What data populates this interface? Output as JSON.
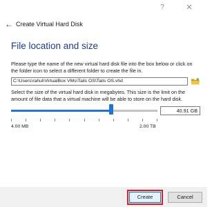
{
  "window": {
    "help_label": "?",
    "close_label": "✕"
  },
  "header": {
    "back_label": "←",
    "title": "Create Virtual Hard Disk"
  },
  "page": {
    "title": "File location and size",
    "location_description": "Please type the name of the new virtual hard disk file into the box below or click on the folder icon to select a different folder to create the file in.",
    "file_path": "C:\\Users\\rahul\\VirtualBox VMs\\Tails OS\\Tails OS.vhd",
    "size_description": "Select the size of the virtual hard disk in megabytes. This size is the limit on the amount of file data that a virtual machine will be able to store on the hard disk.",
    "size_value": "40.91 GB",
    "slider_level": 0.685,
    "min_label": "4.00 MB",
    "max_label": "2.00 TB"
  },
  "buttons": {
    "create_label": "Create",
    "cancel_label": "Cancel"
  },
  "icons": {
    "folder": "folder-icon",
    "back": "back-arrow-icon"
  },
  "colors": {
    "title": "#1e3a9a",
    "accent": "#1e74d8",
    "highlight": "#e31b23",
    "folder": "#e8b22d"
  }
}
